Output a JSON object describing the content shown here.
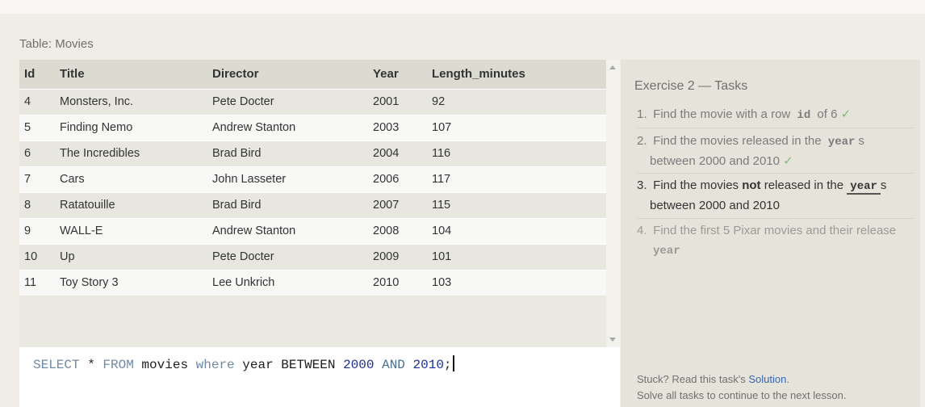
{
  "table_caption": "Table: Movies",
  "table": {
    "columns": [
      "Id",
      "Title",
      "Director",
      "Year",
      "Length_minutes"
    ],
    "rows": [
      [
        "4",
        "Monsters, Inc.",
        "Pete Docter",
        "2001",
        "92"
      ],
      [
        "5",
        "Finding Nemo",
        "Andrew Stanton",
        "2003",
        "107"
      ],
      [
        "6",
        "The Incredibles",
        "Brad Bird",
        "2004",
        "116"
      ],
      [
        "7",
        "Cars",
        "John Lasseter",
        "2006",
        "117"
      ],
      [
        "8",
        "Ratatouille",
        "Brad Bird",
        "2007",
        "115"
      ],
      [
        "9",
        "WALL-E",
        "Andrew Stanton",
        "2008",
        "104"
      ],
      [
        "10",
        "Up",
        "Pete Docter",
        "2009",
        "101"
      ],
      [
        "11",
        "Toy Story 3",
        "Lee Unkrich",
        "2010",
        "103"
      ]
    ]
  },
  "editor": {
    "tokens": [
      {
        "text": "SELECT",
        "kind": "kw"
      },
      {
        "text": " * ",
        "kind": "id"
      },
      {
        "text": "FROM",
        "kind": "kw"
      },
      {
        "text": " movies ",
        "kind": "id"
      },
      {
        "text": "where",
        "kind": "kw"
      },
      {
        "text": " year BETWEEN ",
        "kind": "id"
      },
      {
        "text": "2000",
        "kind": "num"
      },
      {
        "text": " ",
        "kind": "id"
      },
      {
        "text": "AND",
        "kind": "kw"
      },
      {
        "text": " ",
        "kind": "id"
      },
      {
        "text": "2010",
        "kind": "num"
      },
      {
        "text": ";",
        "kind": "id"
      }
    ]
  },
  "tasks": {
    "title": "Exercise 2 — Tasks",
    "items": [
      {
        "number": "1.",
        "line1_pre": "Find the movie with a row ",
        "code": "id",
        "line1_post": " of 6 ",
        "line2": "",
        "check": "✓",
        "state": "done"
      },
      {
        "number": "2.",
        "line1_pre": "Find the movies released in the ",
        "code": "year",
        "line1_post": "s",
        "line2": "between 2000 and 2010 ",
        "check": "✓",
        "state": "done"
      },
      {
        "number": "3.",
        "line1_pre": "Find the movies ",
        "bold": "not",
        "line1_mid": " released in the ",
        "code": "year",
        "line1_post": "s",
        "line2": "between 2000 and 2010",
        "check": "",
        "state": "current"
      },
      {
        "number": "4.",
        "line1_pre": "Find the first 5 Pixar movies and their release",
        "code": "year",
        "line2": "",
        "check": "",
        "state": "future"
      }
    ],
    "footer_prefix": "Stuck? Read this task's ",
    "footer_link": "Solution",
    "footer_suffix": ".",
    "footer_line2": "Solve all tasks to continue to the next lesson."
  },
  "colors": {
    "check": "#80b877",
    "link": "#3366bb",
    "keyword": "#6f89a6",
    "number": "#1b2f9c"
  }
}
